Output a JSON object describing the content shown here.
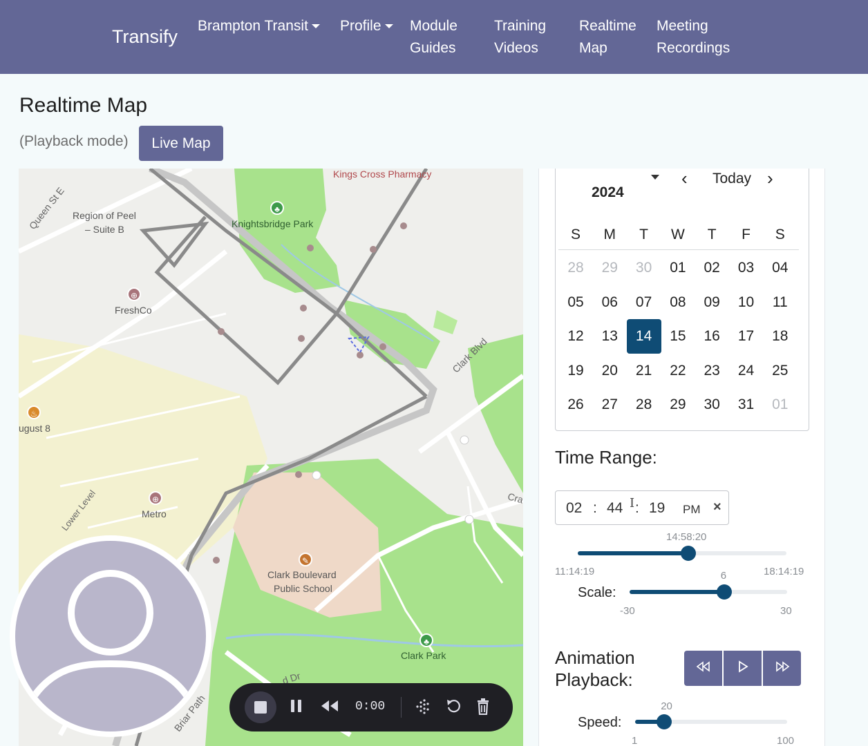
{
  "nav": {
    "brand": "Transify",
    "items": [
      {
        "label": "Brampton Transit",
        "dropdown": true
      },
      {
        "label": "Profile",
        "dropdown": true
      },
      {
        "line1": "Module",
        "line2": "Guides"
      },
      {
        "line1": "Training",
        "line2": "Videos"
      },
      {
        "line1": "Realtime",
        "line2": "Map"
      },
      {
        "line1": "Meeting",
        "line2": "Recordings"
      }
    ]
  },
  "page": {
    "title": "Realtime Map",
    "mode_note": "(Playback mode)",
    "live_button": "Live Map"
  },
  "map": {
    "labels": {
      "queen_st": "Queen St E",
      "region_peel_1": "Region of Peel",
      "region_peel_2": "– Suite B",
      "knightsbridge": "Knightsbridge Park",
      "kings_cross": "Kings Cross Pharmacy",
      "freshco": "FreshCo",
      "clark_blvd": "Clark Blvd",
      "august8": "ugust 8",
      "metro": "Metro",
      "lower_level": "Lower Level",
      "school_1": "Clark Boulevard",
      "school_2": "Public School",
      "clark_park": "Clark Park",
      "briar_path": "Briar Path",
      "dr": "d Dr",
      "cra": "Cra"
    },
    "icons": {
      "park": "tree-icon",
      "shop": "cart-icon",
      "food": "fork-icon",
      "school": "school-icon"
    }
  },
  "audio": {
    "time": "0:00"
  },
  "calendar": {
    "year": "2024",
    "today_label": "Today",
    "weekdays": [
      "S",
      "M",
      "T",
      "W",
      "T",
      "F",
      "S"
    ],
    "weeks": [
      [
        "28",
        "29",
        "30",
        "01",
        "02",
        "03",
        "04"
      ],
      [
        "05",
        "06",
        "07",
        "08",
        "09",
        "10",
        "11"
      ],
      [
        "12",
        "13",
        "14",
        "15",
        "16",
        "17",
        "18"
      ],
      [
        "19",
        "20",
        "21",
        "22",
        "23",
        "24",
        "25"
      ],
      [
        "26",
        "27",
        "28",
        "29",
        "30",
        "31",
        "01"
      ]
    ],
    "muted": [
      [
        0,
        0
      ],
      [
        0,
        1
      ],
      [
        0,
        2
      ],
      [
        4,
        6
      ]
    ],
    "selected": [
      2,
      2
    ]
  },
  "time_range": {
    "title": "Time Range:",
    "hour": "02",
    "minute": "44",
    "second": "19",
    "ampm": "PM",
    "clear": "×",
    "slider_value_label": "14:58:20",
    "slider_fraction": 0.531,
    "min_label": "11:14:19",
    "max_label": "18:14:19"
  },
  "scale": {
    "label": "Scale:",
    "value_label": "6",
    "value": 6,
    "min": -30,
    "max": 30,
    "min_label": "-30",
    "max_label": "30"
  },
  "animation": {
    "title_line1": "Animation",
    "title_line2": "Playback:",
    "rewind_icon": "rewind-icon",
    "play_icon": "play-icon",
    "forward_icon": "fast-forward-icon"
  },
  "speed": {
    "label": "Speed:",
    "value_label": "20",
    "value": 20,
    "min": 1,
    "max": 100,
    "min_label": "1",
    "max_label": "100"
  },
  "colors": {
    "navbar": "#636796",
    "accent": "#0f4c75",
    "park": "#a8e28c",
    "school_area": "#efd9c8"
  }
}
